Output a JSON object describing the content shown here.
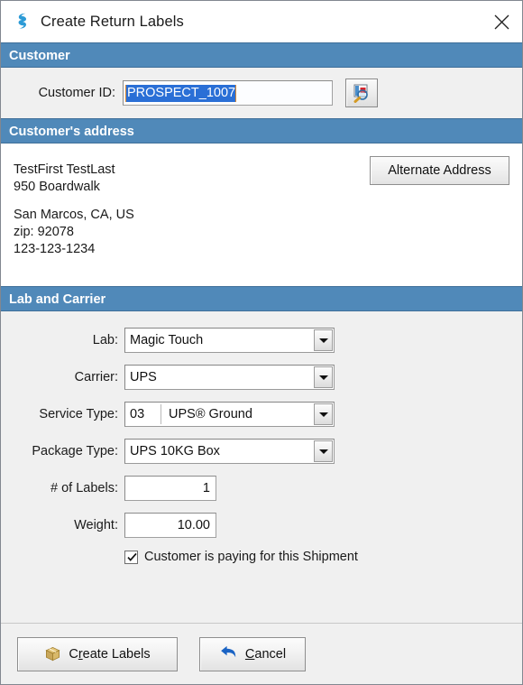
{
  "window": {
    "title": "Create Return Labels",
    "icon": "app-logo-icon",
    "close_label": "×",
    "accent_header_color": "#5089b9",
    "selection_color": "#2a6fd6"
  },
  "sections": {
    "customer": {
      "header": "Customer",
      "customer_id_label": "Customer ID:",
      "customer_id_value": "PROSPECT_1007",
      "customer_id_selected": true,
      "lookup_button_icon": "customer-lookup-icon"
    },
    "address": {
      "header": "Customer's address",
      "name": "TestFirst TestLast",
      "street": "950 Boardwalk",
      "city_state_country": "San Marcos, CA, US",
      "zip": "zip: 92078",
      "phone": "123-123-1234",
      "alternate_address_button": "Alternate Address"
    },
    "lab_and_carrier": {
      "header": "Lab and Carrier",
      "fields": [
        {
          "label": "Lab:",
          "value": "Magic Touch",
          "type": "combo"
        },
        {
          "label": "Carrier:",
          "value": "UPS",
          "type": "combo"
        },
        {
          "label": "Service Type:",
          "code": "03",
          "value": "UPS® Ground",
          "type": "combo-split"
        },
        {
          "label": "Package Type:",
          "value": "UPS 10KG Box",
          "type": "combo"
        },
        {
          "label": "# of Labels:",
          "value": "1",
          "type": "number"
        },
        {
          "label": "Weight:",
          "value": "10.00",
          "type": "number"
        }
      ],
      "checkbox": {
        "label": "Customer is paying for this Shipment",
        "checked": true
      }
    }
  },
  "footer": {
    "create_labels": {
      "pre": "C",
      "mnemonic": "r",
      "post": "eate Labels",
      "icon": "package-box-icon"
    },
    "cancel": {
      "pre": "",
      "mnemonic": "C",
      "post": "ancel",
      "icon": "undo-arrow-icon"
    }
  }
}
